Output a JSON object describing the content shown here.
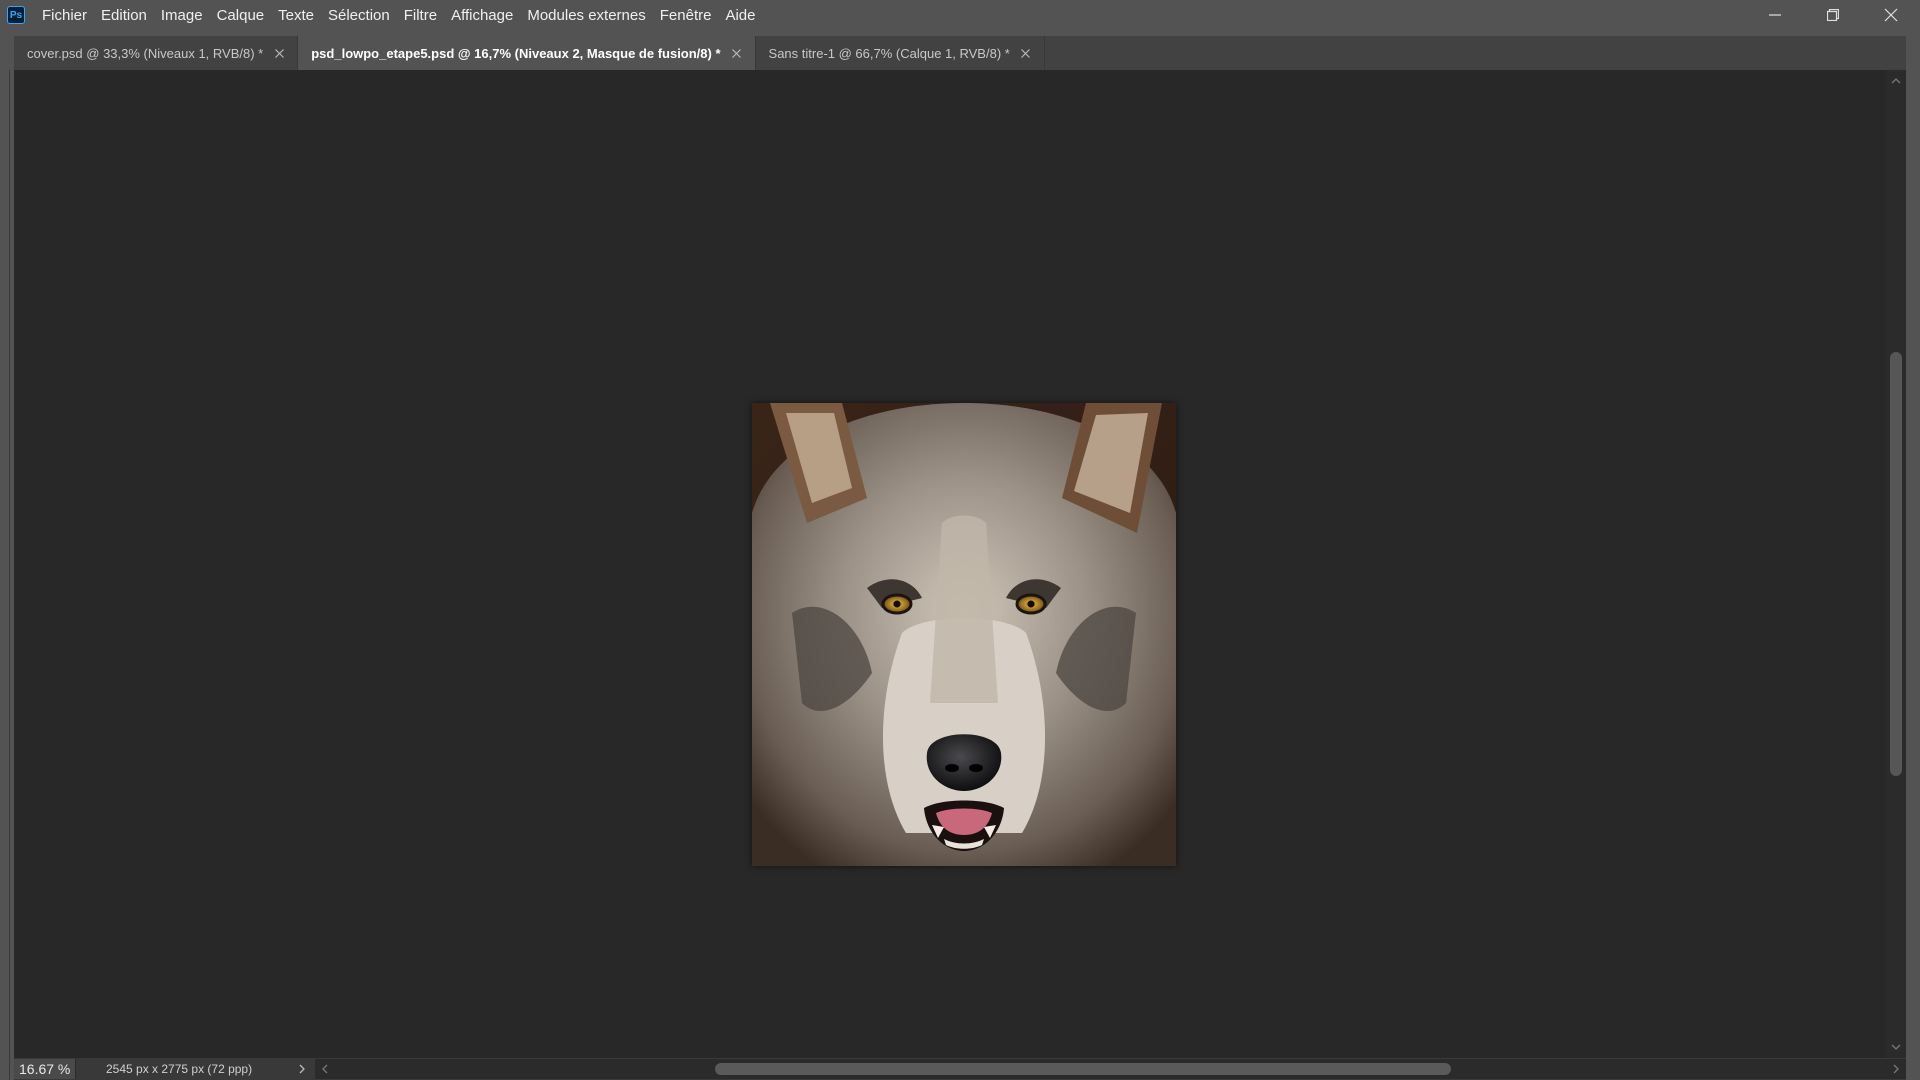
{
  "app": {
    "logo_text": "Ps",
    "accent_color": "#31a8ff"
  },
  "menu": {
    "items": [
      {
        "label": "Fichier"
      },
      {
        "label": "Edition"
      },
      {
        "label": "Image"
      },
      {
        "label": "Calque"
      },
      {
        "label": "Texte"
      },
      {
        "label": "Sélection"
      },
      {
        "label": "Filtre"
      },
      {
        "label": "Affichage"
      },
      {
        "label": "Modules externes"
      },
      {
        "label": "Fenêtre"
      },
      {
        "label": "Aide"
      }
    ]
  },
  "window_controls": {
    "icons": [
      "minimize-icon",
      "restore-icon",
      "close-icon"
    ]
  },
  "tabs": [
    {
      "label": "cover.psd @ 33,3% (Niveaux 1, RVB/8) *",
      "active": false
    },
    {
      "label": "psd_lowpo_etape5.psd @ 16,7% (Niveaux 2, Masque de fusion/8) *",
      "active": true
    },
    {
      "label": "Sans titre-1 @ 66,7% (Calque 1, RVB/8) *",
      "active": false
    }
  ],
  "canvas": {
    "image_subject": "wolf-portrait",
    "background_color": "#282828"
  },
  "status": {
    "zoom": "16.67 %",
    "doc_info": "2545 px x 2775 px (72 ppp)"
  }
}
